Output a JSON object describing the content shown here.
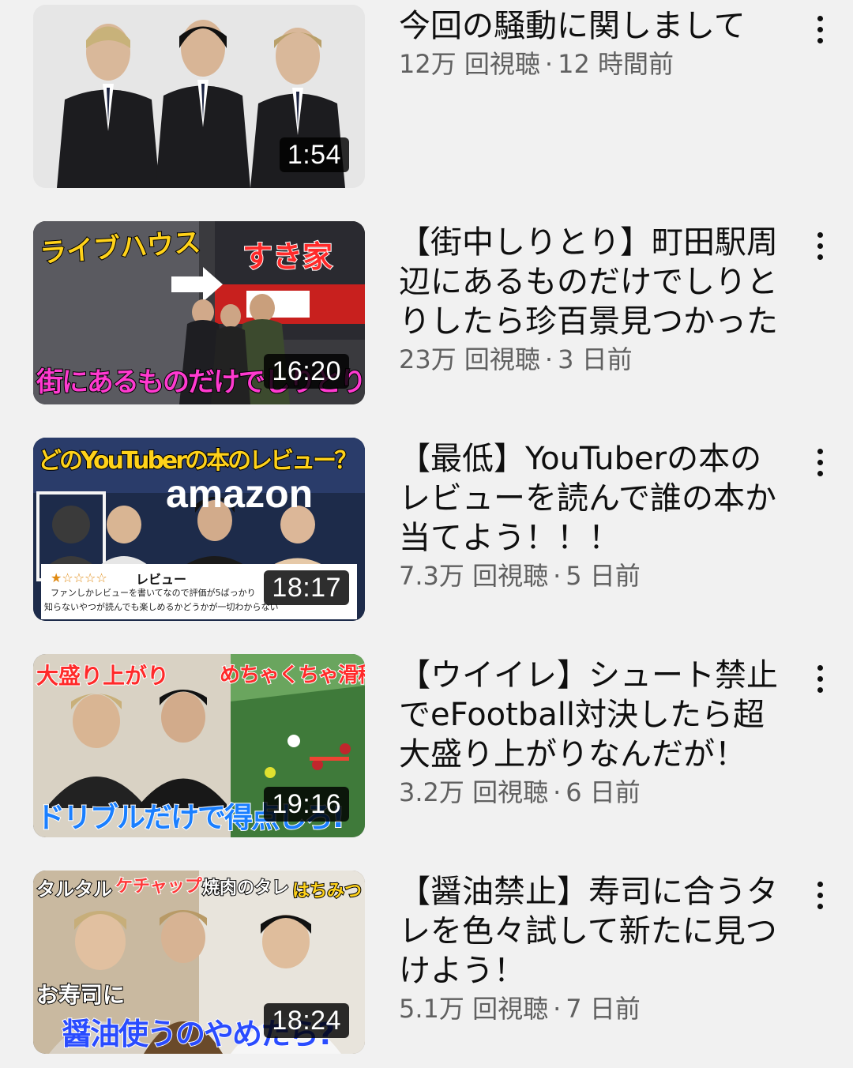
{
  "videos": [
    {
      "title": "今回の騒動に関しまして",
      "views": "12万 回視聴",
      "age": "12 時間前",
      "duration": "1:54",
      "thumb_text": []
    },
    {
      "title": "【街中しりとり】町田駅周辺にあるものだけでしりとりしたら珍百景見つかった",
      "views": "23万 回視聴",
      "age": "3 日前",
      "duration": "16:20",
      "thumb_text": [
        "ライブハウス",
        "すき家",
        "街にあるものだけでしりとり"
      ]
    },
    {
      "title": "【最低】YouTuberの本のレビューを読んで誰の本か当てよう！！！",
      "views": "7.3万 回視聴",
      "age": "5 日前",
      "duration": "18:17",
      "thumb_text": [
        "どのYouTuberの本のレビュー？",
        "amazon",
        "レビュー",
        "ファンしかレビューを書いてなので評価が5ばっかり",
        "知らないやつが読んでも楽しめるかどうかが一切わからない"
      ]
    },
    {
      "title": "【ウイイレ】シュート禁止でeFootball対決したら超大盛り上がりなんだが！",
      "views": "3.2万 回視聴",
      "age": "6 日前",
      "duration": "19:16",
      "thumb_text": [
        "大盛り上がり",
        "めちゃくちゃ滑稽",
        "ドリブルだけで得点しろ!"
      ]
    },
    {
      "title": "【醤油禁止】寿司に合うタレを色々試して新たに見つけよう！",
      "views": "5.1万 回視聴",
      "age": "7 日前",
      "duration": "18:24",
      "thumb_text": [
        "タルタル",
        "ケチャップ",
        "焼肉のタレ",
        "はちみつ",
        "お寿司に",
        "醤油使うのやめたら?"
      ]
    }
  ],
  "separator": "·",
  "icons": {
    "menu": "more-vertical-icon"
  },
  "colors": {
    "background": "#f1f1f1",
    "title": "#0f0f0f",
    "meta": "#606060",
    "duration_bg": "#000000"
  }
}
